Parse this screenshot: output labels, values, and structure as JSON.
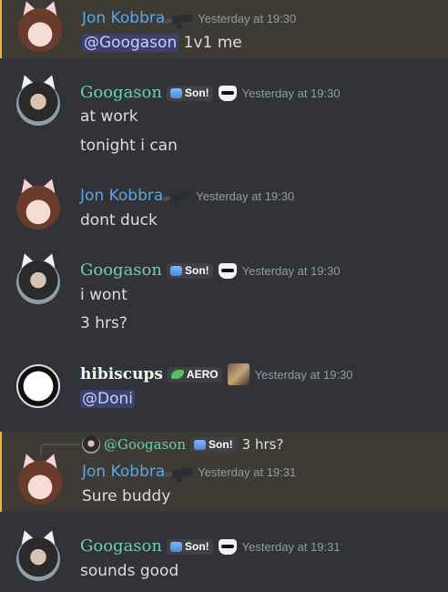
{
  "messages": [
    {
      "user": "Jon Kobbra",
      "time": "Yesterday at 19:30",
      "mention": "@Googason",
      "text": "1v1 me"
    },
    {
      "user": "Googason",
      "tag": "Son!",
      "time": "Yesterday at 19:30",
      "lines": [
        "at work",
        "tonight i can"
      ]
    },
    {
      "user": "Jon Kobbra",
      "time": "Yesterday at 19:30",
      "text": "dont duck"
    },
    {
      "user": "Googason",
      "tag": "Son!",
      "time": "Yesterday at 19:30",
      "lines": [
        "i wont",
        "3 hrs?"
      ]
    },
    {
      "user": "hibiscups",
      "tag": "AERO",
      "time": "Yesterday at 19:30",
      "mention": "@Doni"
    },
    {
      "reply": {
        "user": "@Googason",
        "tag": "Son!",
        "text": "3 hrs?"
      },
      "user": "Jon Kobbra",
      "time": "Yesterday at 19:31",
      "text": "Sure buddy"
    },
    {
      "user": "Googason",
      "tag": "Son!",
      "time": "Yesterday at 19:31",
      "text": "sounds good"
    }
  ],
  "colors": {
    "background": "#313338",
    "mention_bg": "#3d3b34",
    "jon": "#5ba6e6",
    "googason": "#6dd0ad",
    "hibiscups": "#f2f9f0",
    "timestamp": "#949ba4"
  },
  "icons": [
    "gun-icon",
    "cat-sunglasses-icon",
    "dog-icon",
    "son-tag-icon",
    "aero-leaf-icon"
  ]
}
